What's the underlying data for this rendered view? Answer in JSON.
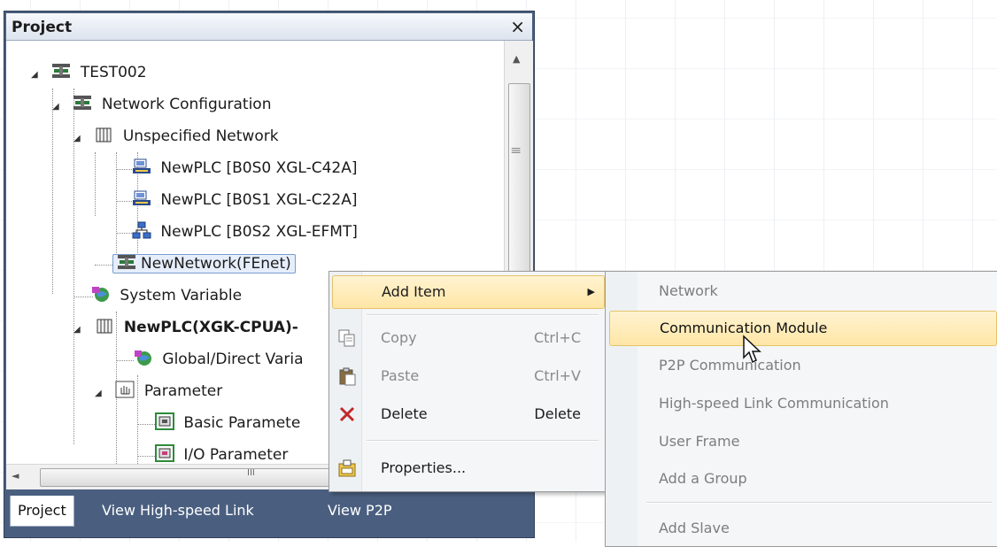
{
  "panel": {
    "title": "Project",
    "close": "×"
  },
  "tree": {
    "items": [
      {
        "label": "TEST002"
      },
      {
        "label": "Network Configuration"
      },
      {
        "label": "Unspecified Network"
      },
      {
        "label": "NewPLC [B0S0 XGL-C42A]"
      },
      {
        "label": "NewPLC [B0S1 XGL-C22A]"
      },
      {
        "label": "NewPLC [B0S2 XGL-EFMT]"
      },
      {
        "label": "NewNetwork(FEnet)"
      },
      {
        "label": "System Variable"
      },
      {
        "label": "NewPLC(XGK-CPUA)-"
      },
      {
        "label": "Global/Direct Varia"
      },
      {
        "label": "Parameter"
      },
      {
        "label": "Basic Paramete"
      },
      {
        "label": "I/O Parameter"
      }
    ]
  },
  "scroll": {
    "up": "▲",
    "left": "◄",
    "grip_v": "|||",
    "grip_h": "III"
  },
  "tabs": [
    {
      "label": "Project"
    },
    {
      "label": "View High-speed Link"
    },
    {
      "label": "View P2P"
    }
  ],
  "context_menu": {
    "items": [
      {
        "label": "Add Item",
        "shortcut": "",
        "arrow": "▶"
      },
      {
        "label": "Copy",
        "shortcut": "Ctrl+C"
      },
      {
        "label": "Paste",
        "shortcut": "Ctrl+V"
      },
      {
        "label": "Delete",
        "shortcut": "Delete"
      },
      {
        "label": "Properties..."
      }
    ]
  },
  "submenu": {
    "items": [
      {
        "label": "Network"
      },
      {
        "label": "Communication Module"
      },
      {
        "label": "P2P Communication"
      },
      {
        "label": "High-speed Link Communication"
      },
      {
        "label": "User Frame"
      },
      {
        "label": "Add a Group"
      },
      {
        "label": "Add Slave"
      }
    ]
  },
  "colors": {
    "panel_bg": "#4a5f80",
    "highlight": "#ffe6a6",
    "delete_icon": "#c0282b"
  }
}
